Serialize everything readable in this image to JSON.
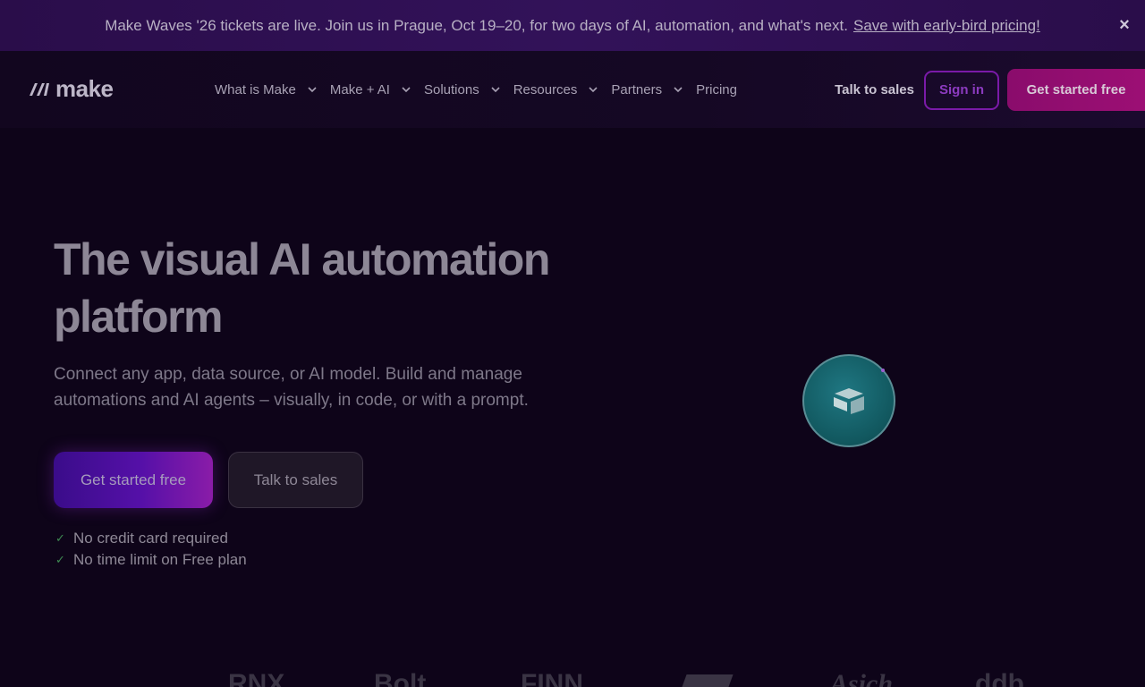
{
  "banner": {
    "message": "Make Waves '26 tickets are live. Join us in Prague, Oct 19–20, for two days of AI, automation, and what's next.",
    "link": "Save with early-bird pricing!",
    "close_icon": "×"
  },
  "header": {
    "logo_text": "make",
    "nav": [
      {
        "label": "What is Make",
        "has_dropdown": true
      },
      {
        "label": "Make + AI",
        "has_dropdown": true
      },
      {
        "label": "Solutions",
        "has_dropdown": true
      },
      {
        "label": "Resources",
        "has_dropdown": true
      },
      {
        "label": "Partners",
        "has_dropdown": true
      },
      {
        "label": "Pricing",
        "has_dropdown": false
      }
    ],
    "talk_to_sales": "Talk to sales",
    "sign_in": "Sign in",
    "get_started": "Get started free"
  },
  "hero": {
    "title_line1": "The visual AI automation",
    "title_line2": "platform",
    "subtitle_line1": "Connect any app, data source, or AI model. Build and manage",
    "subtitle_line2": "automations and AI agents – visually, in code, or with a prompt.",
    "primary_button": "Get started free",
    "secondary_button": "Talk to sales",
    "checks": [
      "No credit card required",
      "No time limit on Free plan"
    ]
  },
  "app_bubble": {
    "icon": "airtable-icon"
  },
  "partner_logos": [
    "RNX",
    "Bolt",
    "FINN",
    "",
    "Asich",
    "ddb"
  ],
  "colors": {
    "background": "#0e0419",
    "banner": "#2a0d4a",
    "accent": "#9c0f74",
    "signin_border": "#7a1aa8",
    "primary_button": "#5510a8",
    "check": "#3e8a52"
  }
}
